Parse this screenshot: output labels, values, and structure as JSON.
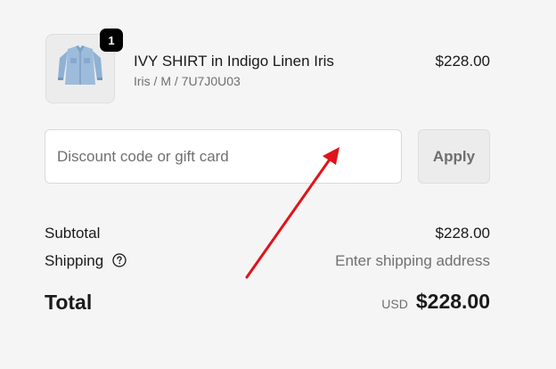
{
  "line_item": {
    "quantity": "1",
    "title": "IVY SHIRT in Indigo Linen Iris",
    "variant": "Iris / M / 7U7J0U03",
    "price": "$228.00",
    "thumbnail_icon": "denim-shirt-image"
  },
  "discount": {
    "placeholder": "Discount code or gift card",
    "value": "",
    "apply_label": "Apply"
  },
  "summary": {
    "subtotal_label": "Subtotal",
    "subtotal_value": "$228.00",
    "shipping_label": "Shipping",
    "shipping_help_icon": "question-circle-icon",
    "shipping_value": "Enter shipping address",
    "total_label": "Total",
    "currency": "USD",
    "total_value": "$228.00"
  },
  "annotation": {
    "arrow_color": "#e0131a",
    "arrow_icon": "red-arrow"
  },
  "colors": {
    "background": "#f5f5f5",
    "badge": "#000000",
    "muted_text": "#707070"
  }
}
